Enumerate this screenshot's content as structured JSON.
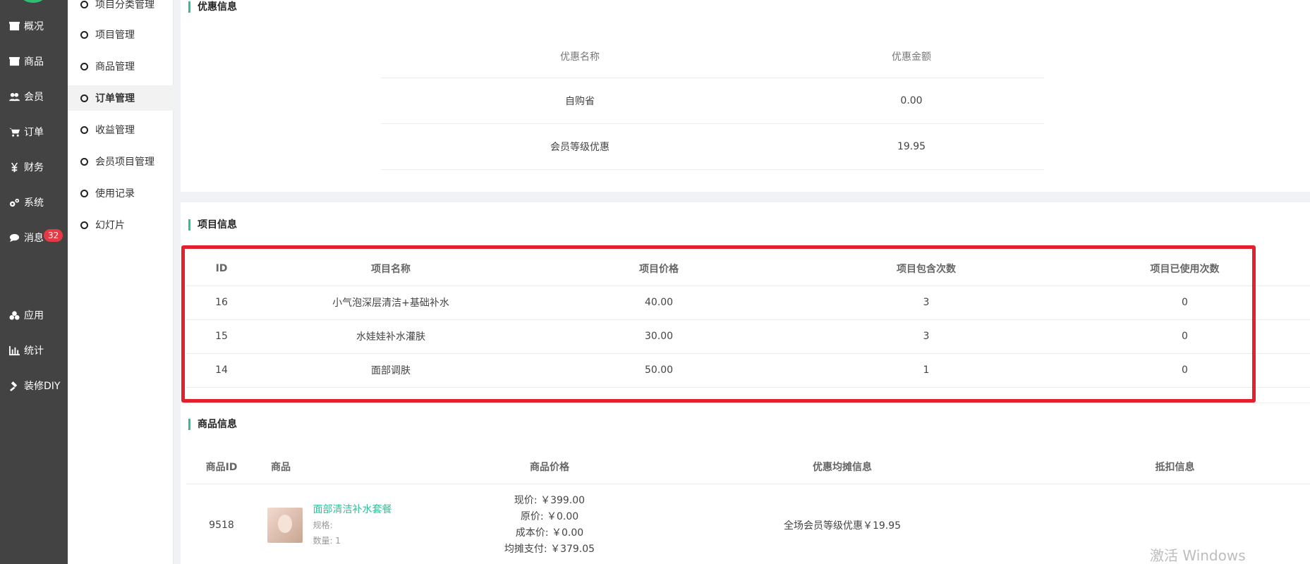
{
  "sidebar": {
    "items": [
      {
        "label": "概况",
        "icon": "box-icon"
      },
      {
        "label": "商品",
        "icon": "box-icon"
      },
      {
        "label": "会员",
        "icon": "users-icon"
      },
      {
        "label": "订单",
        "icon": "cart-icon"
      },
      {
        "label": "财务",
        "icon": "yen-icon"
      },
      {
        "label": "系统",
        "icon": "gears-icon"
      },
      {
        "label": "消息",
        "icon": "chat-icon",
        "badge": "32"
      },
      {
        "label": "应用",
        "icon": "cubes-icon"
      },
      {
        "label": "统计",
        "icon": "bar-chart-icon"
      },
      {
        "label": "装修DIY",
        "icon": "hammer-icon"
      }
    ]
  },
  "subnav": {
    "items": [
      "项目分类管理",
      "项目管理",
      "商品管理",
      "订单管理",
      "收益管理",
      "会员项目管理",
      "使用记录",
      "幻灯片"
    ],
    "active": "订单管理"
  },
  "discount": {
    "title": "优惠信息",
    "headers": [
      "优惠名称",
      "优惠金额"
    ],
    "rows": [
      [
        "自购省",
        "0.00"
      ],
      [
        "会员等级优惠",
        "19.95"
      ]
    ]
  },
  "project": {
    "title": "项目信息",
    "headers": [
      "ID",
      "项目名称",
      "项目价格",
      "项目包含次数",
      "项目已使用次数"
    ],
    "rows": [
      [
        "16",
        "小气泡深层清洁+基础补水",
        "40.00",
        "3",
        "0"
      ],
      [
        "15",
        "水娃娃补水灌肤",
        "30.00",
        "3",
        "0"
      ],
      [
        "14",
        "面部调肤",
        "50.00",
        "1",
        "0"
      ]
    ]
  },
  "goods": {
    "title": "商品信息",
    "headers": [
      "商品ID",
      "商品",
      "商品价格",
      "优惠均摊信息",
      "抵扣信息"
    ],
    "rows": [
      {
        "id": "9518",
        "name": "面部清洁补水套餐",
        "spec": "规格:",
        "qty": "数量: 1",
        "prices": [
          "现价: ￥399.00",
          "原价: ￥0.00",
          "成本价: ￥0.00",
          "均摊支付: ￥379.05"
        ],
        "discount_info": "全场会员等级优惠￥19.95",
        "deduction": ""
      }
    ]
  },
  "watermark": "激活 Windows",
  "colors": {
    "accent": "#2fbf9b",
    "highlight_box": "#e3202e",
    "sidebar": "#434343",
    "badge": "#e33a45"
  }
}
